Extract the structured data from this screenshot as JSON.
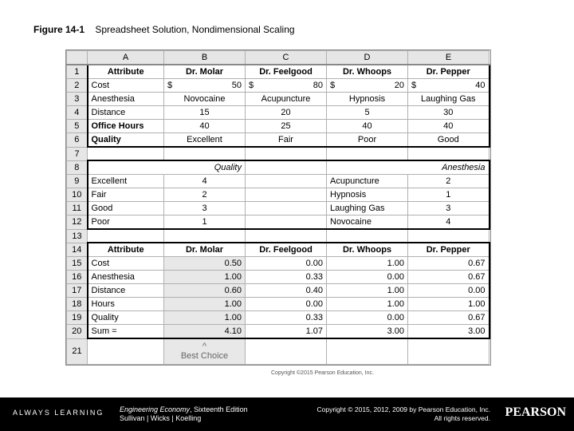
{
  "caption": {
    "figno": "Figure 14-1",
    "title": "Spreadsheet Solution, Nondimensional Scaling"
  },
  "cols": {
    "rowcol": "",
    "A": "A",
    "B": "B",
    "C": "C",
    "D": "D",
    "E": "E"
  },
  "rowlabels": {
    "r1": "1",
    "r2": "2",
    "r3": "3",
    "r4": "4",
    "r5": "5",
    "r6": "6",
    "r7": "7",
    "r8": "8",
    "r9": "9",
    "r10": "10",
    "r11": "11",
    "r12": "12",
    "r13": "13",
    "r14": "14",
    "r15": "15",
    "r16": "16",
    "r17": "17",
    "r18": "18",
    "r19": "19",
    "r20": "20",
    "r21": "21"
  },
  "top": {
    "header": {
      "attr": "Attribute",
      "b": "Dr. Molar",
      "c": "Dr. Feelgood",
      "d": "Dr. Whoops",
      "e": "Dr. Pepper"
    },
    "cost": {
      "a": "Cost",
      "b_pre": "$",
      "b": "50",
      "c_pre": "$",
      "c": "80",
      "d_pre": "$",
      "d": "20",
      "e_pre": "$",
      "e": "40"
    },
    "anesthesia": {
      "a": "Anesthesia",
      "b": "Novocaine",
      "c": "Acupuncture",
      "d": "Hypnosis",
      "e": "Laughing Gas"
    },
    "distance": {
      "a": "Distance",
      "b": "15",
      "c": "20",
      "d": "5",
      "e": "30"
    },
    "hours": {
      "a": "Office Hours",
      "b": "40",
      "c": "25",
      "d": "40",
      "e": "40"
    },
    "quality": {
      "a": "Quality",
      "b": "Excellent",
      "c": "Fair",
      "d": "Poor",
      "e": "Good"
    }
  },
  "lookup": {
    "qhdr": "Quality",
    "ahdr": "Anesthesia",
    "q1a": "Excellent",
    "q1b": "4",
    "a1d": "Acupuncture",
    "a1e": "2",
    "q2a": "Fair",
    "q2b": "2",
    "a2d": "Hypnosis",
    "a2e": "1",
    "q3a": "Good",
    "q3b": "3",
    "a3d": "Laughing Gas",
    "a3e": "3",
    "q4a": "Poor",
    "q4b": "1",
    "a4d": "Novocaine",
    "a4e": "4"
  },
  "bottom": {
    "header": {
      "attr": "Attribute",
      "b": "Dr. Molar",
      "c": "Dr. Feelgood",
      "d": "Dr. Whoops",
      "e": "Dr. Pepper"
    },
    "r15": {
      "a": "Cost",
      "b": "0.50",
      "c": "0.00",
      "d": "1.00",
      "e": "0.67"
    },
    "r16": {
      "a": "Anesthesia",
      "b": "1.00",
      "c": "0.33",
      "d": "0.00",
      "e": "0.67"
    },
    "r17": {
      "a": "Distance",
      "b": "0.60",
      "c": "0.40",
      "d": "1.00",
      "e": "0.00"
    },
    "r18": {
      "a": "Hours",
      "b": "1.00",
      "c": "0.00",
      "d": "1.00",
      "e": "1.00"
    },
    "r19": {
      "a": "Quality",
      "b": "1.00",
      "c": "0.33",
      "d": "0.00",
      "e": "0.67"
    },
    "r20": {
      "a": "Sum =",
      "b": "4.10",
      "c": "1.07",
      "d": "3.00",
      "e": "3.00"
    },
    "r21": {
      "b_arrow": "^",
      "b": "Best Choice"
    }
  },
  "notice": "Copyright ©2015 Pearson Education, Inc.",
  "footer": {
    "always": "ALWAYS LEARNING",
    "book_title": "Engineering Economy",
    "book_edition": ", Sixteenth Edition",
    "authors": "Sullivan | Wicks | Koelling",
    "copy_line1": "Copyright © 2015, 2012, 2009 by Pearson Education, Inc.",
    "copy_line2": "All rights reserved.",
    "logo": "PEARSON"
  },
  "chart_data": {
    "type": "table",
    "title": "Spreadsheet Solution, Nondimensional Scaling",
    "raw_attributes": {
      "columns": [
        "Attribute",
        "Dr. Molar",
        "Dr. Feelgood",
        "Dr. Whoops",
        "Dr. Pepper"
      ],
      "rows": [
        [
          "Cost ($)",
          50,
          80,
          20,
          40
        ],
        [
          "Anesthesia",
          "Novocaine",
          "Acupuncture",
          "Hypnosis",
          "Laughing Gas"
        ],
        [
          "Distance",
          15,
          20,
          5,
          30
        ],
        [
          "Office Hours",
          40,
          25,
          40,
          40
        ],
        [
          "Quality",
          "Excellent",
          "Fair",
          "Poor",
          "Good"
        ]
      ]
    },
    "quality_scale": {
      "Excellent": 4,
      "Good": 3,
      "Fair": 2,
      "Poor": 1
    },
    "anesthesia_scale": {
      "Novocaine": 4,
      "Laughing Gas": 3,
      "Acupuncture": 2,
      "Hypnosis": 1
    },
    "nondimensional": {
      "columns": [
        "Attribute",
        "Dr. Molar",
        "Dr. Feelgood",
        "Dr. Whoops",
        "Dr. Pepper"
      ],
      "rows": [
        [
          "Cost",
          0.5,
          0.0,
          1.0,
          0.67
        ],
        [
          "Anesthesia",
          1.0,
          0.33,
          0.0,
          0.67
        ],
        [
          "Distance",
          0.6,
          0.4,
          1.0,
          0.0
        ],
        [
          "Hours",
          1.0,
          0.0,
          1.0,
          1.0
        ],
        [
          "Quality",
          1.0,
          0.33,
          0.0,
          0.67
        ]
      ],
      "sum": [
        4.1,
        1.07,
        3.0,
        3.0
      ],
      "best_choice": "Dr. Molar"
    }
  }
}
